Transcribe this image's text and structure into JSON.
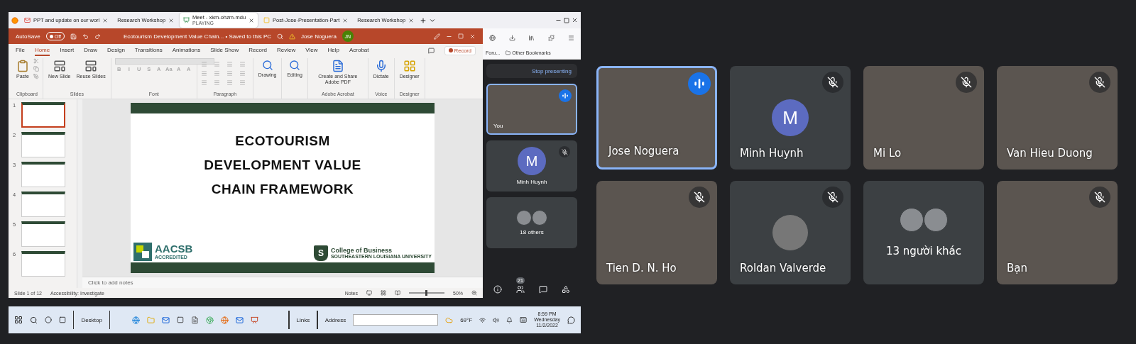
{
  "browser": {
    "tabs": [
      {
        "label": "PPT and update on our worl",
        "selected": false
      },
      {
        "label": "Research Workshop",
        "selected": false
      },
      {
        "label": "Meet - xkm-ohzm-mdu",
        "sublabel": "PLAYING",
        "selected": true
      },
      {
        "label": "Post-Jose-Presentation-Part",
        "selected": false
      },
      {
        "label": "Research Workshop",
        "selected": false
      }
    ],
    "bookmarks": [
      "Foru...",
      "Other Bookmarks"
    ]
  },
  "powerpoint": {
    "autosave": {
      "label": "AutoSave",
      "state_text": "Off",
      "on": false
    },
    "doc_title": "Ecotourism Development Value Chain... • Saved to this PC",
    "user_name": "Jose Noguera",
    "user_initials": "JN",
    "menu_tabs": [
      {
        "label": "File",
        "selected": false
      },
      {
        "label": "Home",
        "selected": true
      },
      {
        "label": "Insert",
        "selected": false
      },
      {
        "label": "Draw",
        "selected": false
      },
      {
        "label": "Design",
        "selected": false
      },
      {
        "label": "Transitions",
        "selected": false
      },
      {
        "label": "Animations",
        "selected": false
      },
      {
        "label": "Slide Show",
        "selected": false
      },
      {
        "label": "Record",
        "selected": false
      },
      {
        "label": "Review",
        "selected": false
      },
      {
        "label": "View",
        "selected": false
      },
      {
        "label": "Help",
        "selected": false
      },
      {
        "label": "Acrobat",
        "selected": false
      }
    ],
    "record_button": "Record",
    "ribbon_groups": [
      {
        "label": "Clipboard",
        "kind": "clipboard",
        "buttons": [
          "Paste"
        ]
      },
      {
        "label": "Slides",
        "kind": "slides",
        "buttons": [
          "New Slide",
          "Reuse Slides"
        ]
      },
      {
        "label": "Font",
        "kind": "font",
        "buttons": [
          "B",
          "I",
          "U",
          "S",
          "A",
          "Aa",
          "A",
          "A"
        ]
      },
      {
        "label": "Paragraph",
        "kind": "paragraph"
      },
      {
        "kind": "big",
        "buttons": [
          "Drawing"
        ]
      },
      {
        "kind": "big",
        "buttons": [
          "Editing"
        ]
      },
      {
        "label": "Adobe Acrobat",
        "kind": "big",
        "buttons": [
          "Create and Share Adobe PDF"
        ]
      },
      {
        "label": "Voice",
        "kind": "big",
        "buttons": [
          "Dictate"
        ]
      },
      {
        "label": "Designer",
        "kind": "big",
        "buttons": [
          "Designer"
        ]
      }
    ],
    "thumbnails": [
      {
        "number": "1",
        "selected": true
      },
      {
        "number": "2",
        "selected": false
      },
      {
        "number": "3",
        "selected": false
      },
      {
        "number": "4",
        "selected": false
      },
      {
        "number": "5",
        "selected": false
      },
      {
        "number": "6",
        "selected": false
      }
    ],
    "slide": {
      "title_lines": [
        "ECOTOURISM",
        "DEVELOPMENT VALUE",
        "CHAIN FRAMEWORK"
      ],
      "left_logo": [
        "AACSB",
        "ACCREDITED"
      ],
      "right_logo_mark": "S",
      "right_logo": [
        "College of Business",
        "SOUTHEASTERN LOUISIANA UNIVERSITY"
      ]
    },
    "notes_placeholder": "Click to add notes",
    "status": {
      "slide_count": "Slide 1 of 12",
      "accessibility": "Accessibility: Investigate",
      "notes": "Notes",
      "zoom": "50%",
      "zoom_slider": {
        "level": 0.5
      }
    }
  },
  "meet_sidebar": {
    "stop_button": "Stop presenting",
    "tiles": [
      {
        "kind": "video",
        "name": "You",
        "speaking": true,
        "muted": false
      },
      {
        "kind": "avatar",
        "name": "Minh Huynh",
        "initial": "M",
        "speaking": false,
        "muted": true
      },
      {
        "kind": "group",
        "name": "18 others"
      }
    ],
    "participant_count": "21"
  },
  "taskbar": {
    "toolbars": [
      "Desktop",
      "Links",
      "Address"
    ],
    "weather": "69°F",
    "time": "8:59 PM",
    "day": "Wednesday",
    "date": "11/2/2022"
  },
  "participants": [
    {
      "kind": "video",
      "name": "Jose Noguera",
      "speaking": true,
      "muted": false
    },
    {
      "kind": "avatar",
      "name": "Minh Huynh",
      "initial": "M",
      "speaking": false,
      "muted": true
    },
    {
      "kind": "video",
      "name": "Mi Lo",
      "speaking": false,
      "muted": true
    },
    {
      "kind": "video",
      "name": "Van Hieu Duong",
      "speaking": false,
      "muted": true
    },
    {
      "kind": "video",
      "name": "Tien D. N. Ho",
      "speaking": false,
      "muted": true
    },
    {
      "kind": "photo",
      "name": "Roldan Valverde",
      "speaking": false,
      "muted": true
    },
    {
      "kind": "group",
      "name": "13 người khác"
    },
    {
      "kind": "video",
      "name": "Bạn",
      "speaking": false,
      "muted": true
    }
  ]
}
